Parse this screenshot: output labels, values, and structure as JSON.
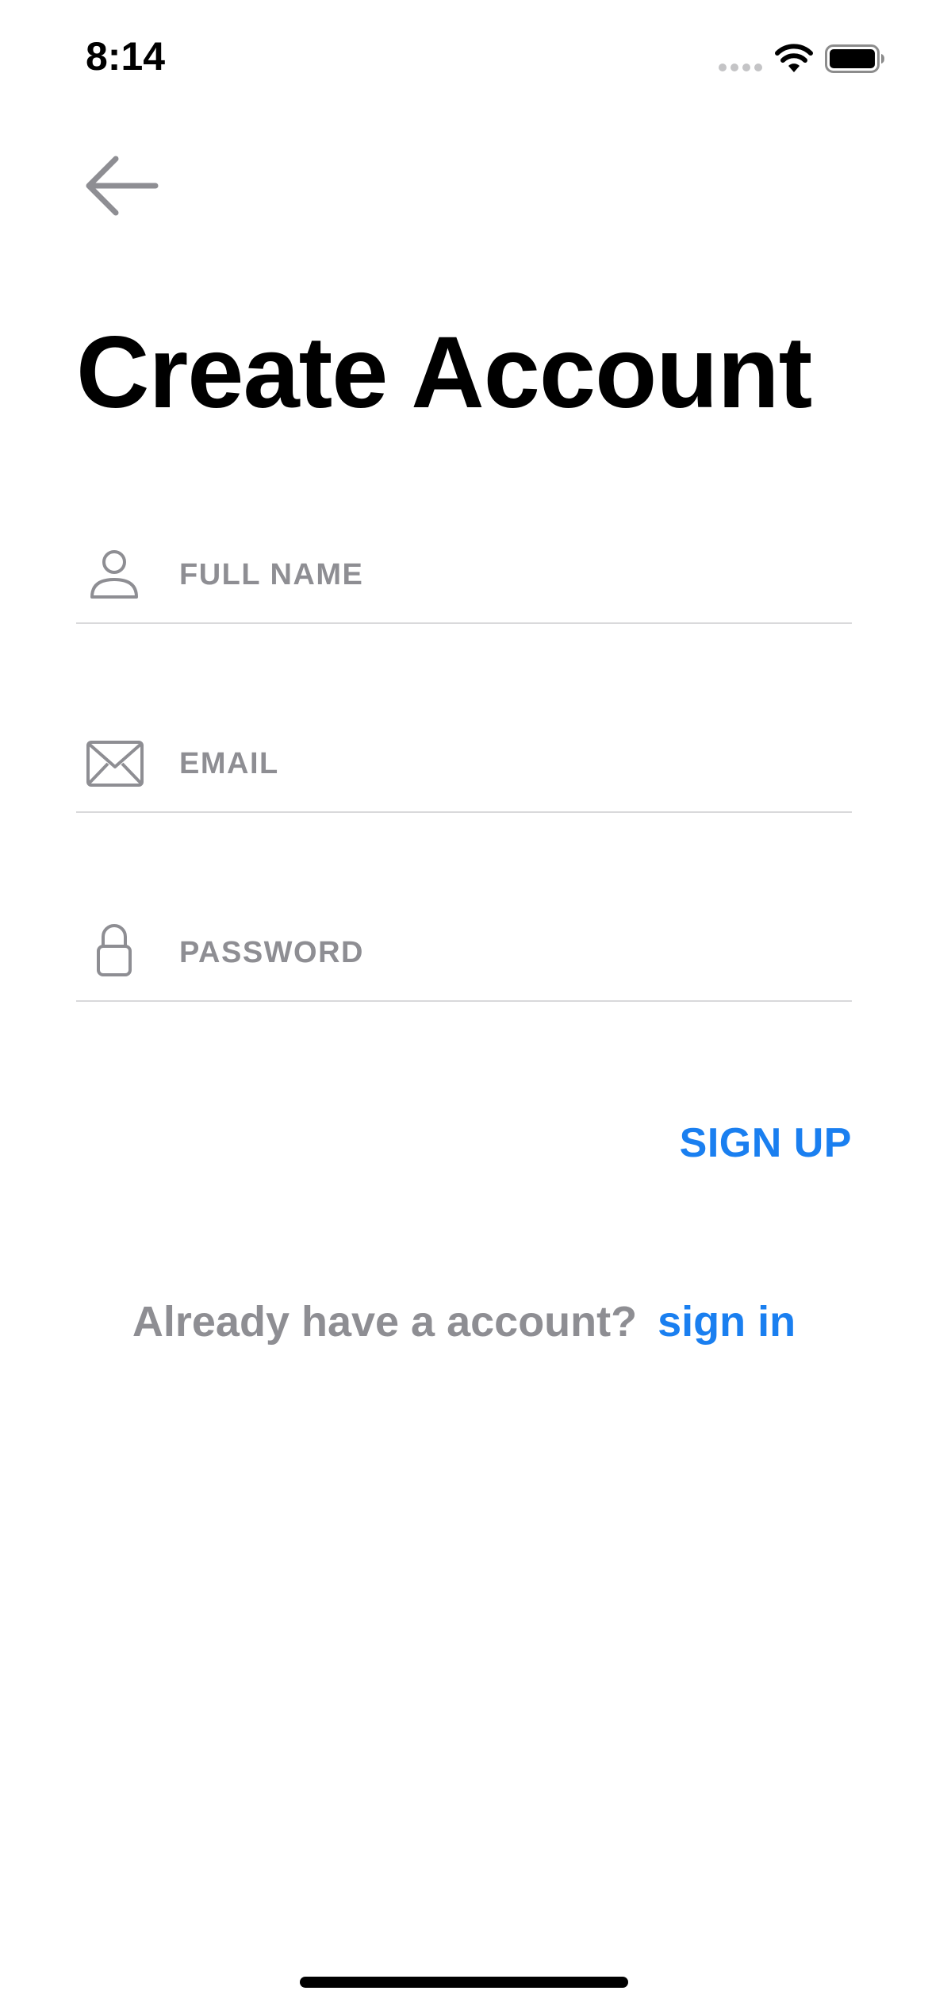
{
  "status_bar": {
    "time": "8:14",
    "signal_icon": "signal-dots-icon",
    "wifi_icon": "wifi-icon",
    "battery_icon": "battery-icon"
  },
  "header": {
    "back_icon": "arrow-left-icon",
    "title": "Create Account"
  },
  "form": {
    "fields": [
      {
        "icon": "person-icon",
        "placeholder": "FULL NAME",
        "value": ""
      },
      {
        "icon": "envelope-icon",
        "placeholder": "EMAIL",
        "value": ""
      },
      {
        "icon": "lock-icon",
        "placeholder": "PASSWORD",
        "value": ""
      }
    ],
    "submit_label": "SIGN UP"
  },
  "footer": {
    "prompt": "Already have a account?",
    "signin_label": "sign in"
  },
  "colors": {
    "accent": "#1A7FF0",
    "muted_text": "#8E8E93",
    "divider": "#D9D9DB",
    "title": "#000000"
  }
}
